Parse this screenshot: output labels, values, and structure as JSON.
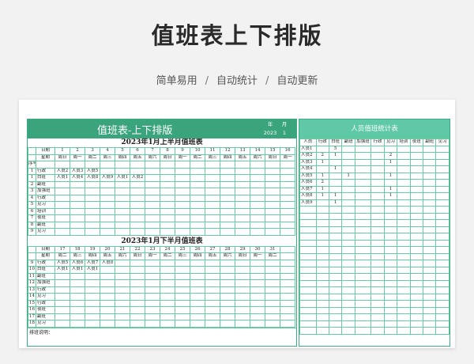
{
  "page": {
    "title": "值班表上下排版",
    "subtitle": [
      "简单易用",
      "自动统计",
      "自动更新"
    ],
    "separator": "/"
  },
  "sheet": {
    "title": "值班表-上下排版",
    "year_label": "年",
    "month_label": "月",
    "year": "2023",
    "month": "1",
    "first_half": {
      "title": "2023年1月上半月值班表",
      "date_label": "日期",
      "dates": [
        "1",
        "2",
        "3",
        "4",
        "5",
        "6",
        "7",
        "8",
        "9",
        "10",
        "11",
        "12",
        "13",
        "14",
        "15",
        "16"
      ],
      "weekday_label": "星期",
      "weekdays": [
        "周日",
        "周一",
        "周二",
        "周三",
        "周四",
        "周五",
        "周六",
        "周日",
        "周一",
        "周二",
        "周三",
        "周四",
        "周五",
        "周六",
        "周日",
        "周一"
      ],
      "index_label": "序号",
      "rows": [
        {
          "no": "1",
          "role": "行政",
          "cells": [
            "人员2",
            "人员3",
            "人员5"
          ]
        },
        {
          "no": "1",
          "role": "白班",
          "cells": [
            "人员1",
            "人员4",
            "人员8",
            "人员9",
            "人员1",
            "人员2"
          ]
        },
        {
          "no": "2",
          "role": "副班",
          "cells": []
        },
        {
          "no": "3",
          "role": "加强班",
          "cells": []
        },
        {
          "no": "4",
          "role": "行政",
          "cells": []
        },
        {
          "no": "5",
          "role": "见习",
          "cells": []
        },
        {
          "no": "6",
          "role": "培训",
          "cells": []
        },
        {
          "no": "7",
          "role": "夜班",
          "cells": []
        },
        {
          "no": "8",
          "role": "副班",
          "cells": []
        },
        {
          "no": "9",
          "role": "见习",
          "cells": []
        }
      ]
    },
    "second_half": {
      "title": "2023年1月下半月值班表",
      "date_label": "日期",
      "dates": [
        "17",
        "18",
        "19",
        "20",
        "21",
        "22",
        "23",
        "24",
        "25",
        "26",
        "27",
        "28",
        "29",
        "30",
        "31"
      ],
      "weekday_label": "星期",
      "weekdays": [
        "周二",
        "周三",
        "周四",
        "周五",
        "周六",
        "周日",
        "周一",
        "周二",
        "周三",
        "周四",
        "周五",
        "周六",
        "周日",
        "周一",
        "周二"
      ],
      "rows": [
        {
          "no": "9",
          "role": "行政",
          "cells": [
            "人员5",
            "人员6",
            "人员7",
            "人员8"
          ]
        },
        {
          "no": "10",
          "role": "白班",
          "cells": [
            "人员1",
            "人员1",
            "人员1"
          ]
        },
        {
          "no": "11",
          "role": "副班",
          "cells": []
        },
        {
          "no": "12",
          "role": "加强班",
          "cells": []
        },
        {
          "no": "13",
          "role": "行政",
          "cells": []
        },
        {
          "no": "14",
          "role": "见习",
          "cells": []
        },
        {
          "no": "15",
          "role": "行政",
          "cells": []
        },
        {
          "no": "16",
          "role": "夜班",
          "cells": []
        },
        {
          "no": "17",
          "role": "副班",
          "cells": []
        },
        {
          "no": "18",
          "role": "见习",
          "cells": []
        }
      ]
    },
    "note_label": "排班说明："
  },
  "stats": {
    "title": "人员值班统计表",
    "headers": [
      "人员",
      "行政",
      "白班",
      "副班",
      "加强班",
      "行政",
      "见习",
      "培训",
      "夜班",
      "副班",
      "见习"
    ],
    "rows": [
      [
        "人员1",
        "",
        "5",
        "",
        "",
        "",
        "",
        "",
        "",
        "",
        ""
      ],
      [
        "人员2",
        "2",
        "1",
        "",
        "",
        "",
        "2",
        "",
        "",
        "",
        ""
      ],
      [
        "人员3",
        "1",
        "",
        "",
        "",
        "",
        "1",
        "",
        "",
        "",
        ""
      ],
      [
        "人员4",
        "",
        "1",
        "",
        "",
        "",
        "",
        "",
        "",
        "",
        ""
      ],
      [
        "人员5",
        "1",
        "",
        "1",
        "",
        "",
        "1",
        "",
        "",
        "",
        ""
      ],
      [
        "人员6",
        "2",
        "",
        "",
        "",
        "",
        "",
        "",
        "",
        "",
        ""
      ],
      [
        "人员7",
        "1",
        "",
        "",
        "",
        "",
        "1",
        "",
        "",
        "",
        ""
      ],
      [
        "人员8",
        "1",
        "1",
        "",
        "",
        "",
        "1",
        "",
        "",
        "",
        ""
      ],
      [
        "人员9",
        "",
        "1",
        "",
        "",
        "",
        "",
        "",
        "",
        "",
        ""
      ]
    ],
    "blank_rows": 19
  },
  "colors": {
    "accent": "#3aa47d",
    "accent_light": "#5ec8a7",
    "grid": "#6cc7a3"
  }
}
